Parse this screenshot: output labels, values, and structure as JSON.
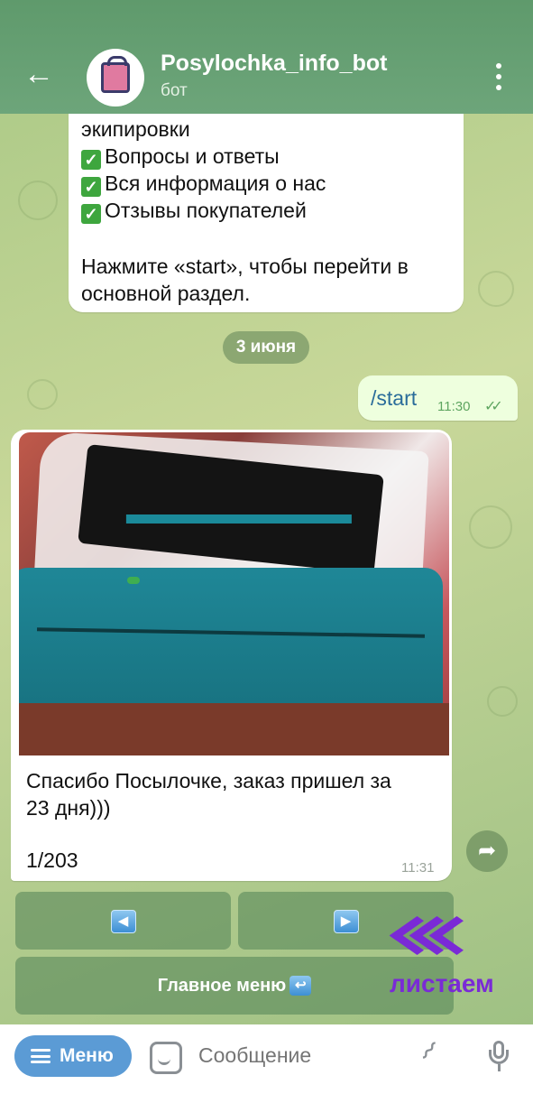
{
  "header": {
    "title": "Posylochka_info_bot",
    "subtitle": "бот"
  },
  "messages": {
    "bot_intro": {
      "line_partial": "экипировки",
      "items": [
        "Вопросы и ответы",
        "Вся информация о нас",
        "Отзывы покупателей"
      ],
      "instruction_line1": "Нажмите «start», чтобы перейти в",
      "instruction_line2": "основной раздел."
    },
    "date_separator": "3 июня",
    "user_command": {
      "text": "/start",
      "time": "11:30"
    },
    "review": {
      "caption_line1": "Спасибо Посылочке, заказ пришел за",
      "caption_line2": "23 дня)))",
      "counter": "1/203",
      "time": "11:31"
    }
  },
  "keyboard": {
    "prev_icon": "◀",
    "next_icon": "▶",
    "main_menu_label": "Главное меню",
    "main_menu_icon": "↩"
  },
  "watermark": {
    "text": "листаем"
  },
  "composer": {
    "menu_label": "Меню",
    "placeholder": "Сообщение"
  },
  "colors": {
    "header": "#5f9a6c",
    "outgoing_bubble": "#eeffde",
    "menu_button": "#5b9bd5",
    "watermark": "#7a2ad6"
  }
}
